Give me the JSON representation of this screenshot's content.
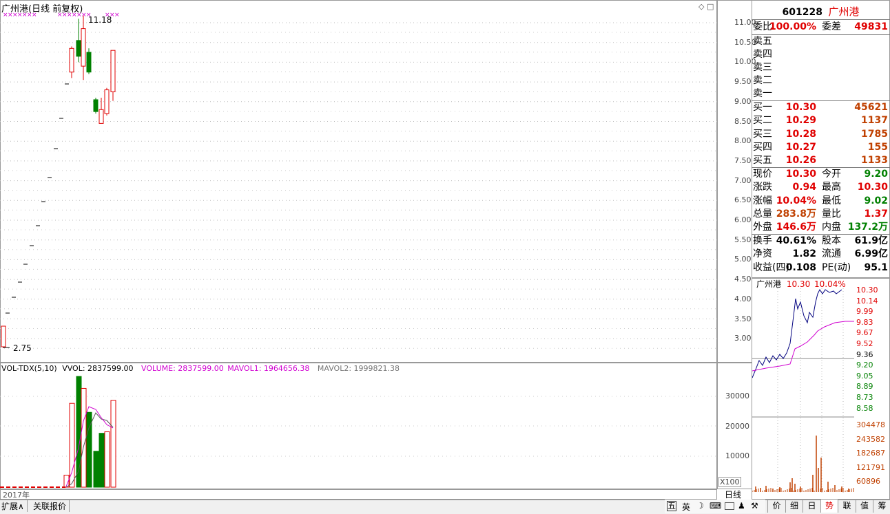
{
  "chart_title": "广州港(日线 前复权)",
  "kline": {
    "max_label": "11.18",
    "min_label": "2.75",
    "y_ticks": [
      "11.00",
      "10.50",
      "10.00",
      "9.50",
      "9.00",
      "8.50",
      "8.00",
      "7.50",
      "7.00",
      "6.50",
      "6.00",
      "5.50",
      "5.00",
      "4.50",
      "4.00",
      "3.50",
      "3.00"
    ]
  },
  "vol": {
    "title": "VOL-TDX(5,10)",
    "vvol": "VVOL: 2837599.00",
    "volume": "VOLUME: 2837599.00",
    "mavol1": "MAVOL1: 1964656.38",
    "mavol2": "MAVOL2: 1999821.38",
    "y_ticks": [
      "30000",
      "20000",
      "10000"
    ],
    "unit": "X100"
  },
  "year_label": "2017年",
  "period_label": "日线",
  "bottom_tabs": {
    "expand": "扩展∧",
    "linked": "关联报价"
  },
  "right_tabs": [
    "价",
    "细",
    "日",
    "势",
    "联",
    "值",
    "筹"
  ],
  "tray_icons": [
    "五",
    "英"
  ],
  "quote": {
    "code": "601228",
    "name": "广州港",
    "weibi_label": "委比",
    "weibi": "100.00%",
    "weicha_label": "委差",
    "weicha": "49831",
    "sells": [
      "卖五",
      "卖四",
      "卖三",
      "卖二",
      "卖一"
    ],
    "buys": [
      {
        "label": "买一",
        "price": "10.30",
        "vol": "45621"
      },
      {
        "label": "买二",
        "price": "10.29",
        "vol": "1137"
      },
      {
        "label": "买三",
        "price": "10.28",
        "vol": "1785"
      },
      {
        "label": "买四",
        "price": "10.27",
        "vol": "155"
      },
      {
        "label": "买五",
        "price": "10.26",
        "vol": "1133"
      }
    ],
    "stats1": [
      {
        "l": "现价",
        "v": "10.30",
        "l2": "今开",
        "v2": "9.20"
      },
      {
        "l": "涨跌",
        "v": "0.94",
        "l2": "最高",
        "v2": "10.30"
      },
      {
        "l": "涨幅",
        "v": "10.04%",
        "l2": "最低",
        "v2": "9.02"
      },
      {
        "l": "总量",
        "v": "283.8万",
        "l2": "量比",
        "v2": "1.37"
      },
      {
        "l": "外盘",
        "v": "146.6万",
        "l2": "内盘",
        "v2": "137.2万"
      }
    ],
    "stats2": [
      {
        "l": "换手",
        "v": "40.61%",
        "l2": "股本",
        "v2": "61.9亿"
      },
      {
        "l": "净资",
        "v": "1.82",
        "l2": "流通",
        "v2": "6.99亿"
      },
      {
        "l": "收益(四)",
        "v": "0.108",
        "l2": "PE(动)",
        "v2": "95.1"
      }
    ]
  },
  "intraday": {
    "name": "广州港",
    "price": "10.30",
    "pct": "10.04%",
    "price_ticks": [
      "10.30",
      "10.14",
      "9.99",
      "9.83",
      "9.67",
      "9.52",
      "9.36",
      "9.20",
      "9.05",
      "8.89",
      "8.73",
      "8.58"
    ],
    "vol_ticks": [
      "304478",
      "243582",
      "182687",
      "121791",
      "60896"
    ]
  },
  "colors": {
    "up": "#e00000",
    "down": "#008000",
    "ma1": "#d000d0",
    "line": "#00007f"
  }
}
